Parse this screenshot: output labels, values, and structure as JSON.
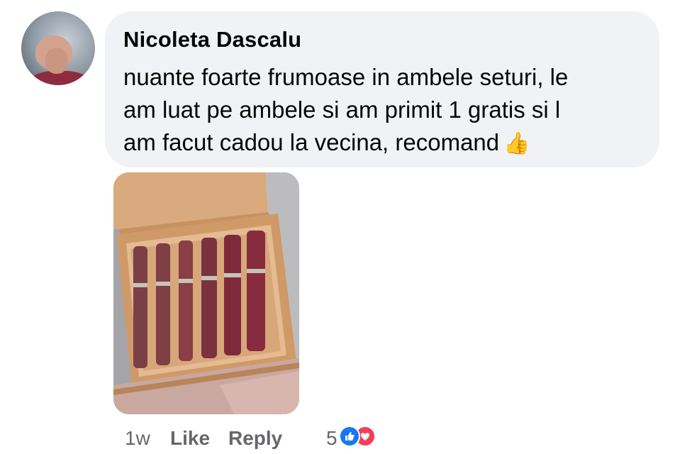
{
  "comment": {
    "author": "Nicoleta Dascalu",
    "text_lines": [
      "nuante foarte frumoase in ambele seturi, le",
      "am luat pe ambele si am primit 1 gratis si l",
      "am facut cadou la vecina, recomand"
    ],
    "emoji": "👍",
    "timestamp": "1w",
    "like_label": "Like",
    "reply_label": "Reply",
    "reaction_count": "5",
    "reactions": [
      "like-icon",
      "love-icon"
    ],
    "colors": {
      "bubble": "#f0f2f5",
      "author": "#050505",
      "meta": "#65676b",
      "like_blue": "#1877f2",
      "love_red": "#f33e58"
    }
  },
  "attachment": {
    "icon": "photo-lipstick-set"
  }
}
